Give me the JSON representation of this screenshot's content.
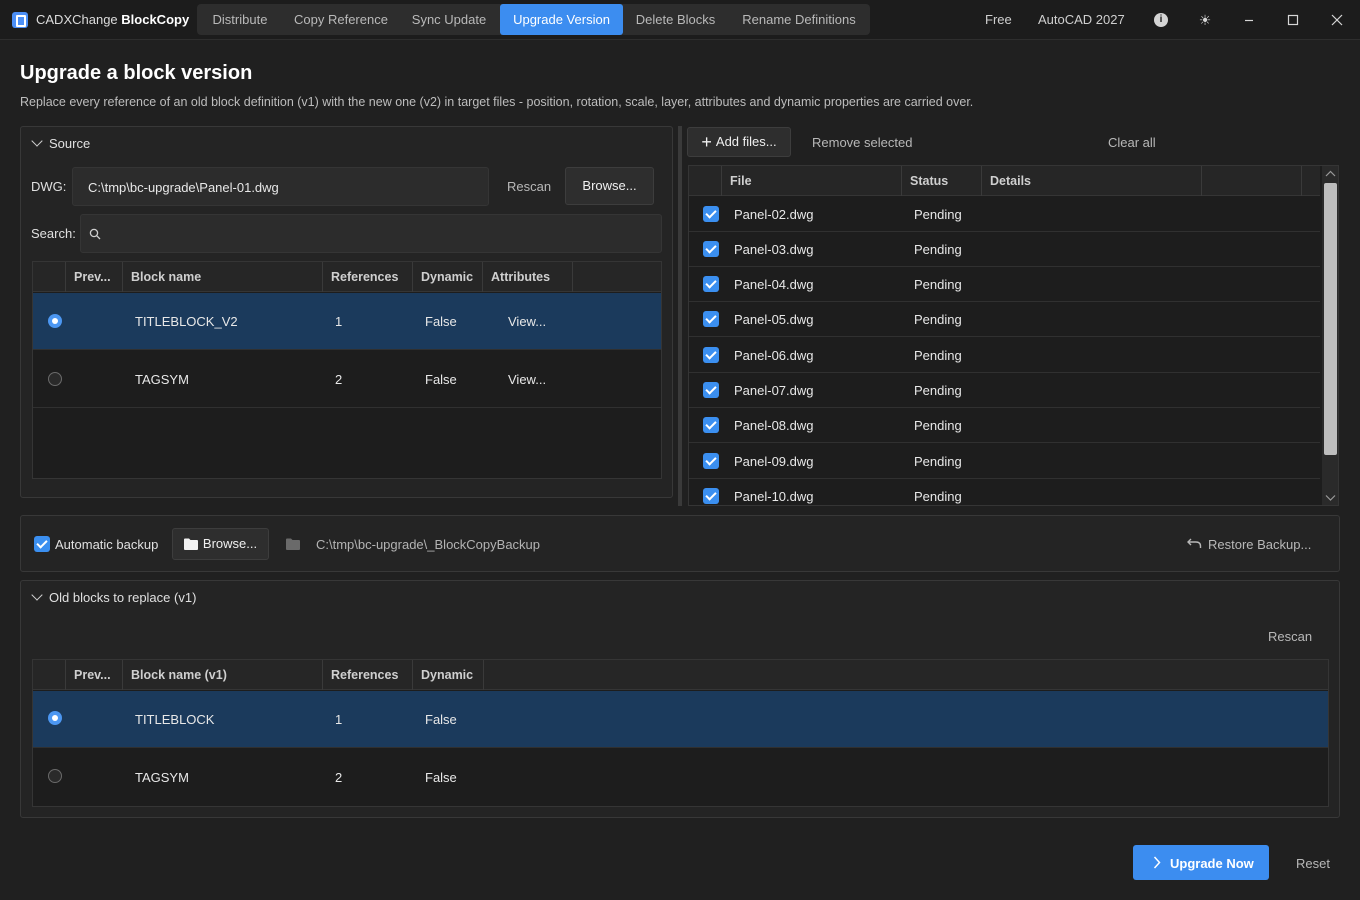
{
  "app": {
    "title_prefix": "CADXChange",
    "title_bold": "BlockCopy",
    "tabs": [
      "Distribute",
      "Copy Reference",
      "Sync Update",
      "Upgrade Version",
      "Delete Blocks",
      "Rename Definitions"
    ],
    "active_tab": "Upgrade Version",
    "license": "Free",
    "cad_version": "AutoCAD 2027"
  },
  "header": {
    "title": "Upgrade a block version",
    "subtitle": "Replace every reference of an old block definition (v1) with the new one (v2) in target files - position, rotation, scale, layer, attributes and dynamic properties are carried over."
  },
  "source": {
    "section_label": "Source",
    "dwg_label": "DWG:",
    "dwg_value": "C:\\tmp\\bc-upgrade\\Panel-01.dwg",
    "rescan_label": "Rescan",
    "browse_label": "Browse...",
    "search_label": "Search:",
    "search_value": "",
    "columns": [
      "Prev...",
      "Block name",
      "References",
      "Dynamic",
      "Attributes"
    ],
    "rows": [
      {
        "selected": true,
        "name": "TITLEBLOCK_V2",
        "refs": "1",
        "dynamic": "False",
        "attributes": "View..."
      },
      {
        "selected": false,
        "name": "TAGSYM",
        "refs": "2",
        "dynamic": "False",
        "attributes": "View..."
      }
    ]
  },
  "targets": {
    "add_label": "Add files...",
    "remove_label": "Remove selected",
    "clear_label": "Clear all",
    "columns": [
      "File",
      "Status",
      "Details"
    ],
    "rows": [
      {
        "checked": true,
        "file": "Panel-02.dwg",
        "status": "Pending",
        "details": ""
      },
      {
        "checked": true,
        "file": "Panel-03.dwg",
        "status": "Pending",
        "details": ""
      },
      {
        "checked": true,
        "file": "Panel-04.dwg",
        "status": "Pending",
        "details": ""
      },
      {
        "checked": true,
        "file": "Panel-05.dwg",
        "status": "Pending",
        "details": ""
      },
      {
        "checked": true,
        "file": "Panel-06.dwg",
        "status": "Pending",
        "details": ""
      },
      {
        "checked": true,
        "file": "Panel-07.dwg",
        "status": "Pending",
        "details": ""
      },
      {
        "checked": true,
        "file": "Panel-08.dwg",
        "status": "Pending",
        "details": ""
      },
      {
        "checked": true,
        "file": "Panel-09.dwg",
        "status": "Pending",
        "details": ""
      },
      {
        "checked": true,
        "file": "Panel-10.dwg",
        "status": "Pending",
        "details": ""
      }
    ]
  },
  "backup": {
    "checkbox_label": "Automatic backup",
    "checked": true,
    "browse_label": "Browse...",
    "path": "C:\\tmp\\bc-upgrade\\_BlockCopyBackup",
    "restore_label": "Restore Backup..."
  },
  "old_blocks": {
    "section_label": "Old blocks to replace (v1)",
    "rescan_label": "Rescan",
    "columns": [
      "Prev...",
      "Block name (v1)",
      "References",
      "Dynamic"
    ],
    "rows": [
      {
        "selected": true,
        "name": "TITLEBLOCK",
        "refs": "1",
        "dynamic": "False"
      },
      {
        "selected": false,
        "name": "TAGSYM",
        "refs": "2",
        "dynamic": "False"
      }
    ]
  },
  "footer": {
    "upgrade_label": "Upgrade Now",
    "reset_label": "Reset"
  },
  "colors": {
    "accent": "#3c8df0",
    "background": "#202020",
    "selected_row": "#1b3a5c"
  }
}
